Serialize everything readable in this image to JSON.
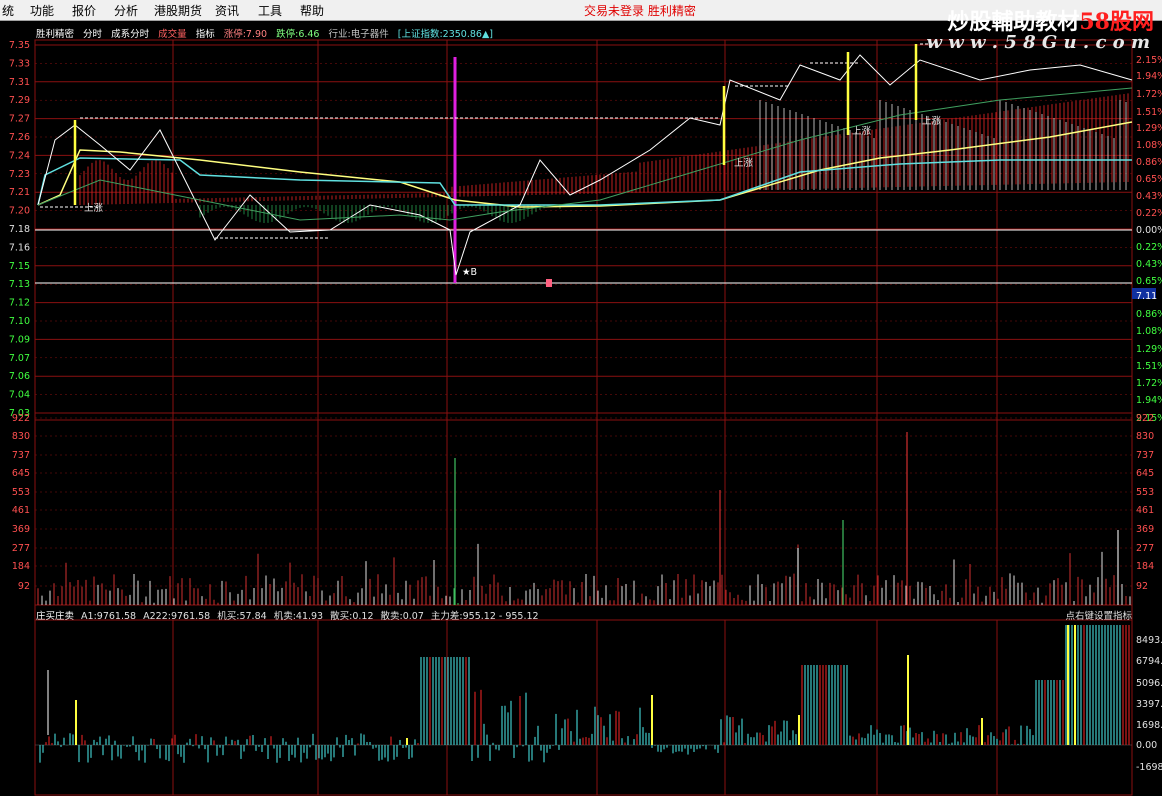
{
  "menu": {
    "items": [
      "统",
      "功能",
      "报价",
      "分析",
      "港股期货",
      "资讯",
      "工具",
      "帮助"
    ],
    "notice": "交易未登录  胜利精密"
  },
  "watermark": {
    "main_prefix": "炒股輔助教材",
    "main_brand": "58股网",
    "url": "w w w . 5 8 G u . c o m"
  },
  "info": {
    "stock": "胜利精密",
    "mode": "分时",
    "indicator": "成系分时",
    "volume_label": "成交量",
    "index_label": "指标",
    "limit_up": "涨停:7.90",
    "limit_down": "跌停:6.46",
    "industry": "行业:电子器件",
    "index_quote": "[上证指数:2350.86▲]"
  },
  "price_axis": {
    "left": [
      "7.35",
      "7.33",
      "7.31",
      "7.29",
      "7.27",
      "7.26",
      "7.24",
      "7.23",
      "7.21",
      "7.20",
      "7.18",
      "7.16",
      "7.15",
      "7.13",
      "7.12",
      "7.10",
      "7.09",
      "7.07",
      "7.06",
      "7.04",
      "7.03"
    ],
    "right": [
      "2.15%",
      "1.94%",
      "1.72%",
      "1.51%",
      "1.29%",
      "1.08%",
      "0.86%",
      "0.65%",
      "0.43%",
      "0.22%",
      "0.00%",
      "0.22%",
      "0.43%",
      "0.65%",
      "7.11",
      "0.86%",
      "1.08%",
      "1.29%",
      "1.51%",
      "1.72%",
      "1.94%",
      "2.15%"
    ]
  },
  "volume_axis": {
    "labels": [
      "922",
      "830",
      "737",
      "645",
      "553",
      "461",
      "369",
      "277",
      "184",
      "92"
    ]
  },
  "sub_axis": {
    "labels": [
      "8493.3",
      "6794.6",
      "5096.0",
      "3397.3",
      "1698.6",
      "0.00",
      "-1698.6"
    ]
  },
  "sub_info": {
    "title": "庄买庄卖",
    "a1": "A1:9761.58",
    "a222": "A222:9761.58",
    "inst_buy": "机买:57.84",
    "inst_sell": "机卖:41.93",
    "retail_buy": "散买:0.12",
    "retail_sell": "散卖:0.07",
    "main_diff": "主力差:955.12 - 955.12",
    "right_hint": "点右键设置指标"
  },
  "chart_labels": {
    "b_marker": "B",
    "tags": [
      "上涨",
      "上涨",
      "上涨",
      "上涨"
    ]
  },
  "colors": {
    "grid": "#8a1010",
    "price_line": "#ffffff",
    "avg_line": "#ffff80",
    "cyan_line": "#60e0e0",
    "volume": "#d0d0d0",
    "up": "#e02020",
    "down": "#40c8c8"
  }
}
